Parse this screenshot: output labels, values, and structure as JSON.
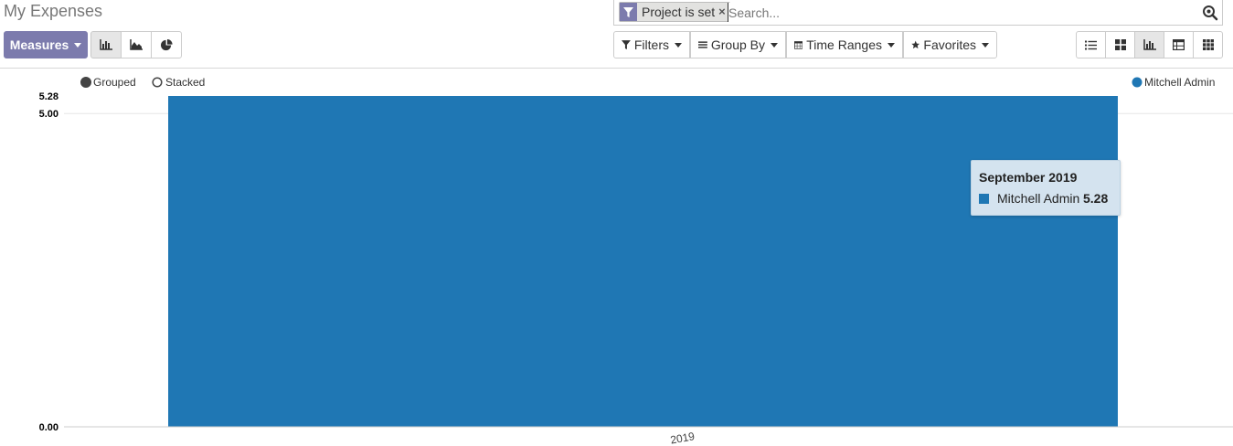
{
  "page_title": "My Expenses",
  "search": {
    "facet_label": "Project is set",
    "facet_remove": "×",
    "placeholder": "Search..."
  },
  "toolbar": {
    "measures_label": "Measures",
    "filters_label": "Filters",
    "groupby_label": "Group By",
    "timeranges_label": "Time Ranges",
    "favorites_label": "Favorites"
  },
  "chart_options": {
    "grouped_label": "Grouped",
    "stacked_label": "Stacked",
    "selected_mode": "grouped"
  },
  "tooltip": {
    "title": "September 2019",
    "series": "Mitchell Admin",
    "value": "5.28"
  },
  "colors": {
    "accent": "#7c7bad",
    "series_1": "#1f77b4",
    "tooltip_bg": "#d4e3ef"
  },
  "chart_data": {
    "type": "bar",
    "categories": [
      "September 2019"
    ],
    "series": [
      {
        "name": "Mitchell Admin",
        "values": [
          5.28
        ]
      }
    ],
    "y_tick_labels": [
      "0.00",
      "5.00",
      "5.28"
    ],
    "ylim": [
      0,
      5.28
    ],
    "x_tick_label_visible": "2019",
    "legend_position": "top-right",
    "grid": true
  }
}
